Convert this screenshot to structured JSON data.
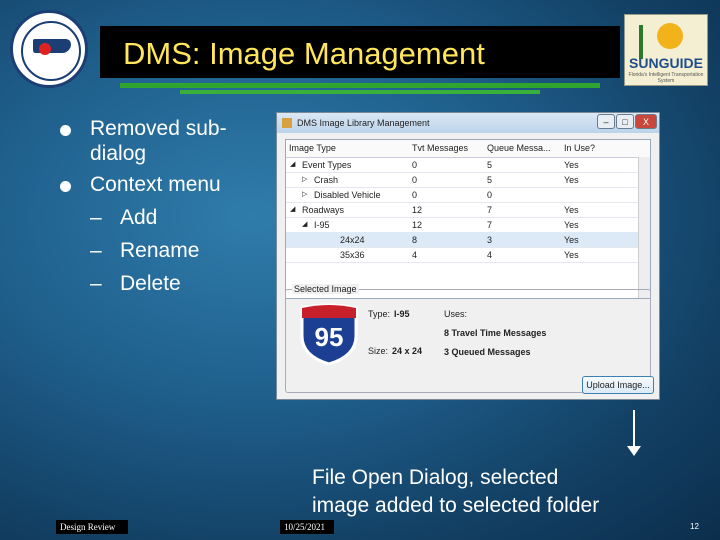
{
  "slide": {
    "title": "DMS: Image Management",
    "bullets": [
      "Removed sub-dialog",
      "Context menu"
    ],
    "sub_bullets": [
      "Add",
      "Rename",
      "Delete"
    ],
    "sub_dash": "–",
    "caption_line1": "File Open Dialog, selected",
    "caption_line2": "image added to selected folder",
    "footer_left": "Design Review",
    "footer_date": "10/25/2021",
    "page_number": "12",
    "logo_left": "seal-logo",
    "logo_right_text": "SUNGUIDE",
    "logo_right_tagline": "Florida's Intelligent Transportation System"
  },
  "dialog": {
    "title": "DMS Image Library Management",
    "buttons": {
      "minimize": "–",
      "maximize": "□",
      "close": "X"
    },
    "columns": [
      "Image Type",
      "Tvt Messages",
      "Queue Messa...",
      "In Use?"
    ],
    "rows": [
      {
        "indent": 0,
        "expander": "◢",
        "name": "Event Types",
        "tvt": "0",
        "queue": "5",
        "inuse": "Yes"
      },
      {
        "indent": 1,
        "expander": "▷",
        "name": "Crash",
        "tvt": "0",
        "queue": "5",
        "inuse": "Yes"
      },
      {
        "indent": 1,
        "expander": "▷",
        "name": "Disabled Vehicle",
        "tvt": "0",
        "queue": "0",
        "inuse": ""
      },
      {
        "indent": 0,
        "expander": "◢",
        "name": "Roadways",
        "tvt": "12",
        "queue": "7",
        "inuse": "Yes"
      },
      {
        "indent": 1,
        "expander": "◢",
        "name": "I-95",
        "tvt": "12",
        "queue": "7",
        "inuse": "Yes"
      },
      {
        "indent": 2,
        "expander": "",
        "name": "24x24",
        "tvt": "8",
        "queue": "3",
        "inuse": "Yes"
      },
      {
        "indent": 2,
        "expander": "",
        "name": "35x36",
        "tvt": "4",
        "queue": "4",
        "inuse": "Yes"
      }
    ],
    "selected_group_label": "Selected Image",
    "shield_number": "95",
    "type_label": "Type:",
    "type_value": "I-95",
    "size_label": "Size:",
    "size_value": "24 x 24",
    "uses_label": "Uses:",
    "uses_line1": "8 Travel Time Messages",
    "uses_line2": "3 Queued Messages",
    "upload_button": "Upload Image..."
  },
  "colors": {
    "title": "#ffe65a",
    "rule": "#2fa52f",
    "accent_blue": "#1b3e74"
  }
}
